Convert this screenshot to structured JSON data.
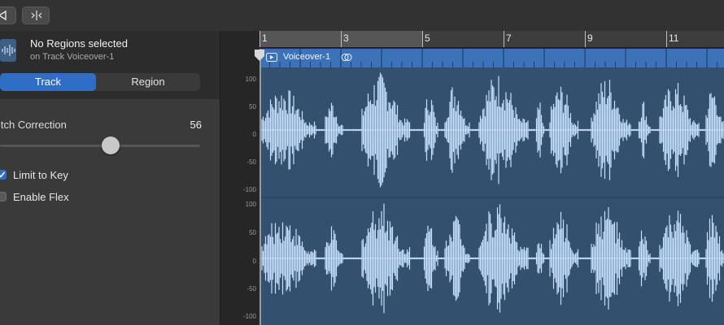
{
  "toolbar": {
    "buttons": [
      {
        "icon": "play-back-icon"
      },
      {
        "icon": "split-icon"
      }
    ]
  },
  "inspector": {
    "header": {
      "title": "No Regions selected",
      "subtitle": "on Track Voiceover-1",
      "icon": "waveform-icon"
    },
    "tabs": [
      {
        "label": "Track",
        "selected": true
      },
      {
        "label": "Region",
        "selected": false
      }
    ],
    "pitch_correction": {
      "label": "itch Correction",
      "value": "56",
      "level": 0.56
    },
    "checkboxes": [
      {
        "label": "Limit to Key",
        "checked": true
      },
      {
        "label": "Enable Flex",
        "checked": false
      }
    ]
  },
  "editor": {
    "ruler": [
      "1",
      "3",
      "5",
      "7",
      "9",
      "11"
    ],
    "region_name": "Voiceover-1",
    "amplitude_labels": [
      "100",
      "50",
      "0",
      "-50",
      "-100"
    ]
  },
  "colors": {
    "accent": "#2f6ec6",
    "region": "#3c72b8",
    "wave": "#c8e0ff",
    "wave_bg": "#33506f"
  }
}
